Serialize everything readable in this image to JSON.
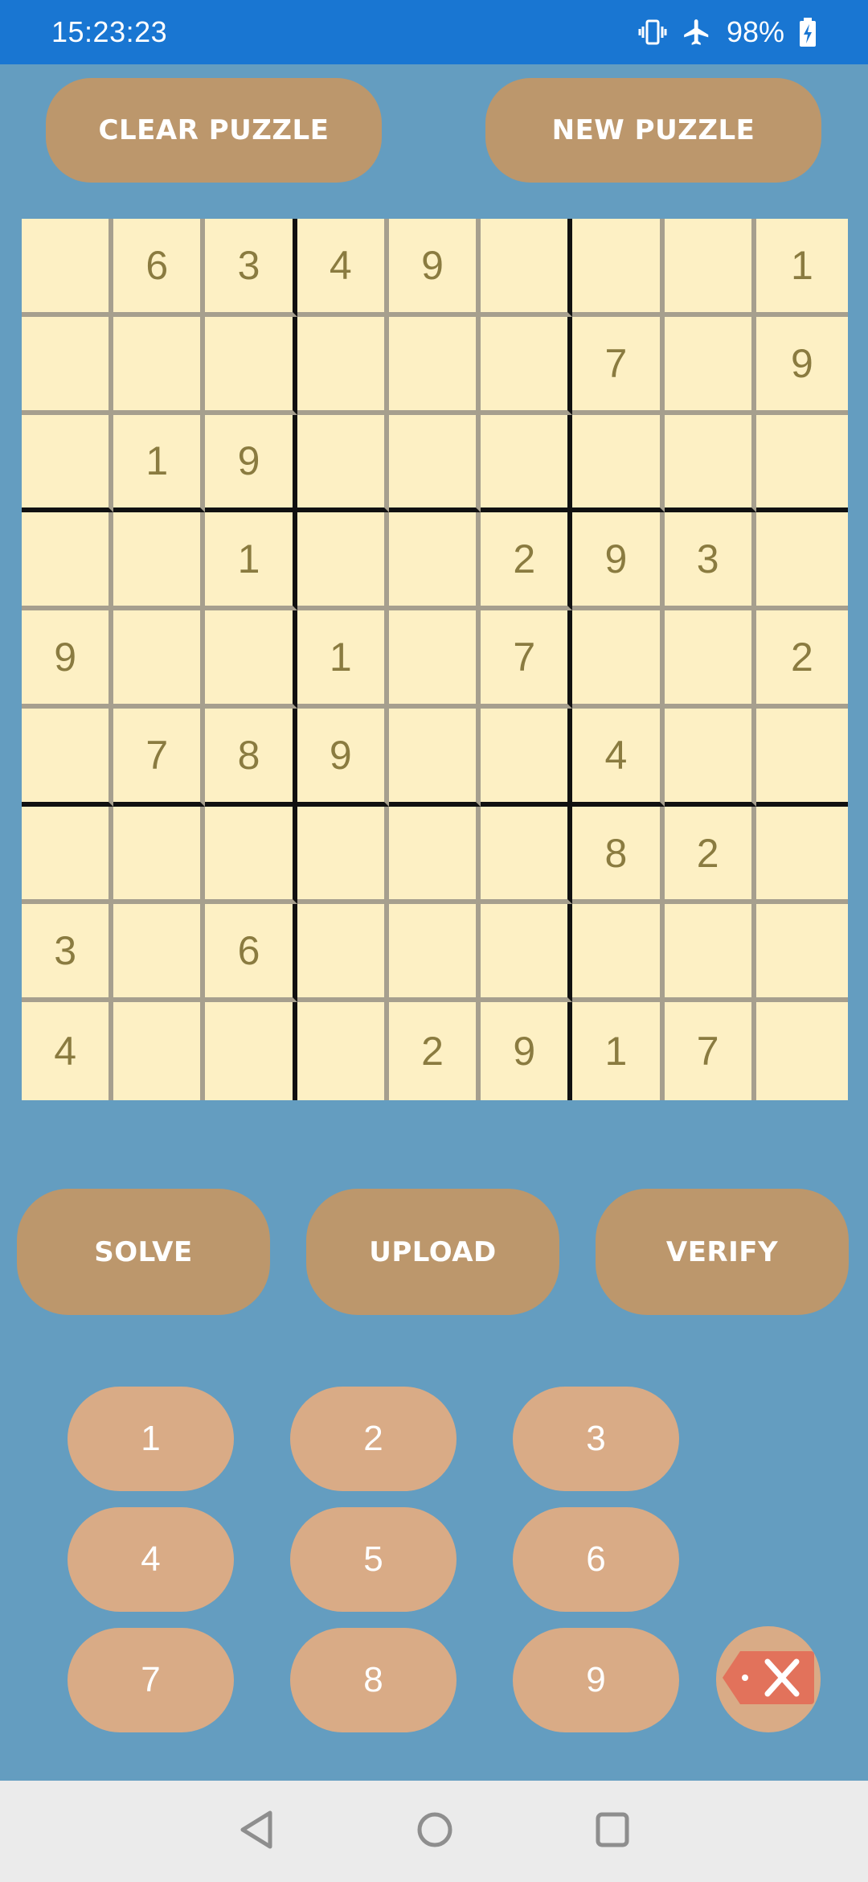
{
  "status_bar": {
    "time": "15:23:23",
    "battery_percent": "98%",
    "icons": [
      "vibrate-icon",
      "airplane-mode-icon",
      "battery-charging-icon"
    ]
  },
  "top_buttons": {
    "clear_label": "CLEAR PUZZLE",
    "new_label": "NEW PUZZLE"
  },
  "grid": {
    "rows": [
      [
        "",
        "6",
        "3",
        "4",
        "9",
        "",
        "",
        "",
        "1"
      ],
      [
        "",
        "",
        "",
        "",
        "",
        "",
        "7",
        "",
        "9"
      ],
      [
        "",
        "1",
        "9",
        "",
        "",
        "",
        "",
        "",
        ""
      ],
      [
        "",
        "",
        "1",
        "",
        "",
        "2",
        "9",
        "3",
        ""
      ],
      [
        "9",
        "",
        "",
        "1",
        "",
        "7",
        "",
        "",
        "2"
      ],
      [
        "",
        "7",
        "8",
        "9",
        "",
        "",
        "4",
        "",
        ""
      ],
      [
        "",
        "",
        "",
        "",
        "",
        "",
        "8",
        "2",
        ""
      ],
      [
        "3",
        "",
        "6",
        "",
        "",
        "",
        "",
        "",
        ""
      ],
      [
        "4",
        "",
        "",
        "",
        "2",
        "9",
        "1",
        "7",
        ""
      ]
    ]
  },
  "actions": {
    "solve_label": "SOLVE",
    "upload_label": "UPLOAD",
    "verify_label": "VERIFY"
  },
  "keypad": {
    "keys": [
      "1",
      "2",
      "3",
      "4",
      "5",
      "6",
      "7",
      "8",
      "9"
    ],
    "backspace_icon": "backspace-icon"
  },
  "nav_bar": {
    "icons": [
      "back-icon",
      "home-icon",
      "recents-icon"
    ]
  },
  "colors": {
    "background": "#649DC0",
    "status_bar": "#1976D2",
    "primary_button": "#BC976C",
    "keypad_button": "#D9AB86",
    "cell_background": "#FDF0C4",
    "cell_digit": "#8A7B40",
    "backspace_red": "#E2725B"
  }
}
